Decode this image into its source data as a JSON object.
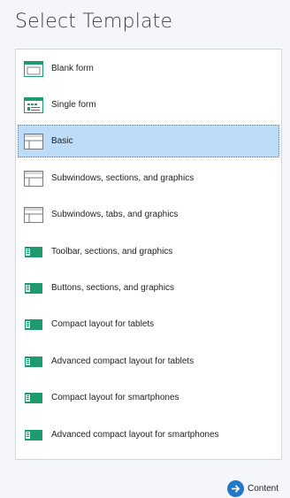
{
  "header": {
    "title": "Select Template"
  },
  "templates": [
    {
      "label": "Blank form",
      "icon": "blank-form-icon",
      "selected": false
    },
    {
      "label": "Single form",
      "icon": "single-form-icon",
      "selected": false
    },
    {
      "label": "Basic",
      "icon": "basic-layout-icon",
      "selected": true
    },
    {
      "label": "Subwindows, sections, and graphics",
      "icon": "subwindows-sections-icon",
      "selected": false
    },
    {
      "label": "Subwindows, tabs, and graphics",
      "icon": "subwindows-tabs-icon",
      "selected": false
    },
    {
      "label": "Toolbar, sections, and graphics",
      "icon": "toolbar-layout-icon",
      "selected": false
    },
    {
      "label": "Buttons, sections, and graphics",
      "icon": "buttons-layout-icon",
      "selected": false
    },
    {
      "label": "Compact layout for tablets",
      "icon": "compact-layout-icon",
      "selected": false
    },
    {
      "label": "Advanced compact layout for tablets",
      "icon": "compact-layout-icon",
      "selected": false
    },
    {
      "label": "Compact layout for smartphones",
      "icon": "compact-layout-icon",
      "selected": false
    },
    {
      "label": "Advanced compact layout for smartphones",
      "icon": "compact-layout-icon",
      "selected": false
    }
  ],
  "footer": {
    "next_label": "Content",
    "next_icon": "arrow-right-circle-icon"
  },
  "colors": {
    "selected_bg": "#bcdcf7",
    "accent": "#1f78c8",
    "icon_green": "#1e9a6f"
  }
}
